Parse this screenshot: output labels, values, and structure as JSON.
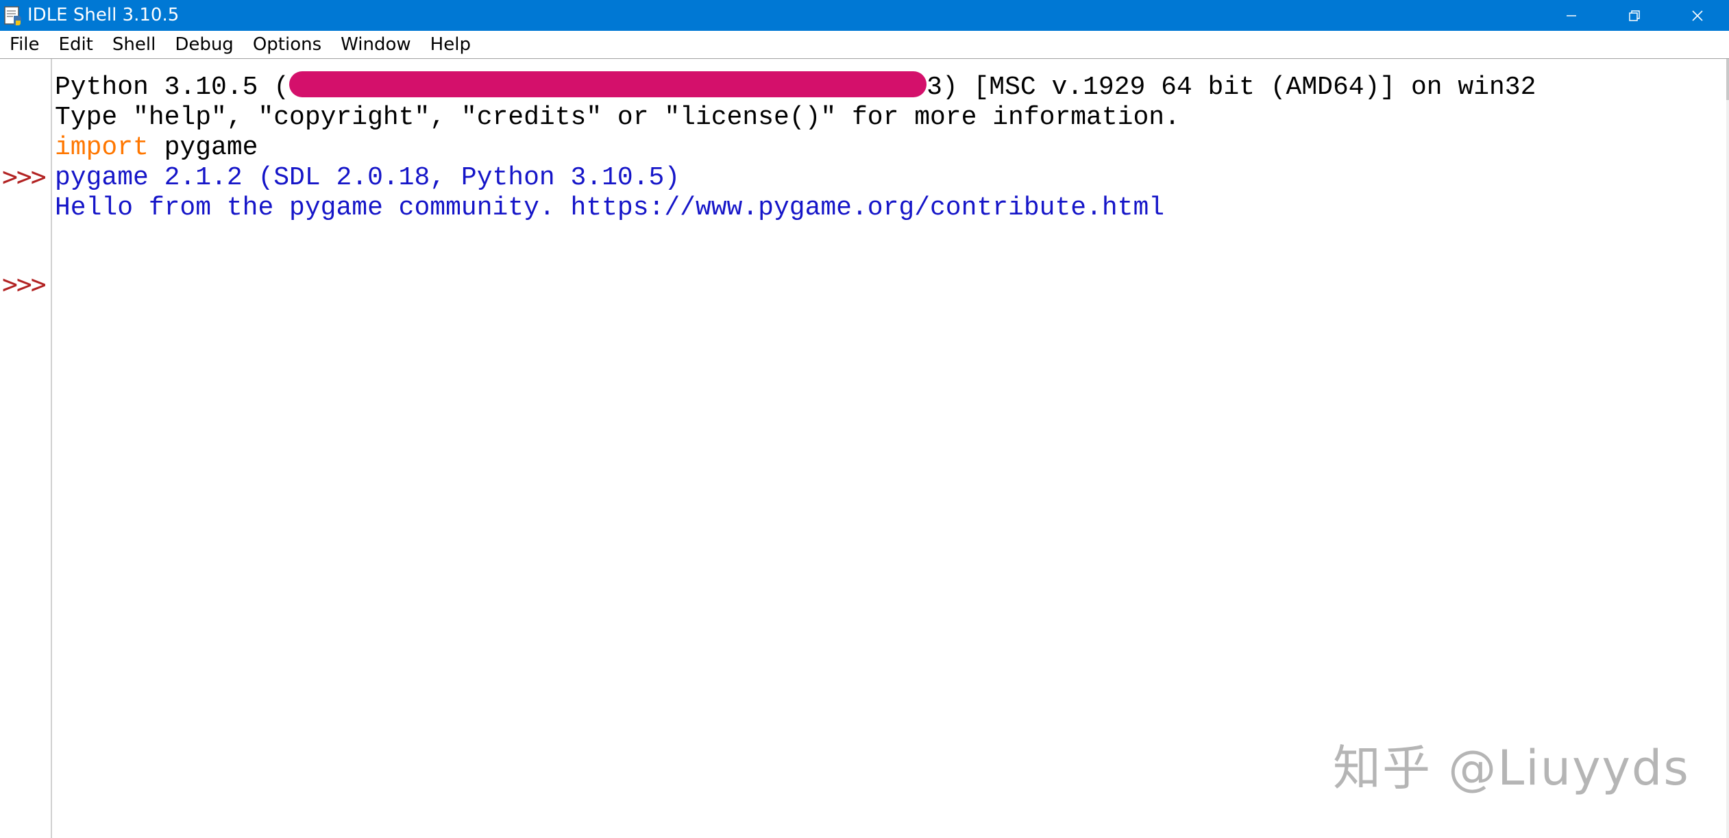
{
  "window": {
    "title": "IDLE Shell 3.10.5",
    "icon": "python-idle-icon",
    "controls": {
      "minimize_icon": "minimize-icon",
      "maximize_icon": "restore-icon",
      "close_icon": "close-icon"
    }
  },
  "menu": {
    "items": [
      {
        "label": "File"
      },
      {
        "label": "Edit"
      },
      {
        "label": "Shell"
      },
      {
        "label": "Debug"
      },
      {
        "label": "Options"
      },
      {
        "label": "Window"
      },
      {
        "label": "Help"
      }
    ]
  },
  "shell": {
    "prompt": ">>>",
    "banner_line1_prefix": "Python 3.10.5 (",
    "banner_line1_suffix": "3) [MSC v.1929 64 bit (AMD64)] on win32",
    "banner_line2": "Type \"help\", \"copyright\", \"credits\" or \"license()\" for more information.",
    "input_keyword": "import",
    "input_rest": " pygame",
    "output_line1": "pygame 2.1.2 (SDL 2.0.18, Python 3.10.5)",
    "output_line2": "Hello from the pygame community. https://www.pygame.org/contribute.html"
  },
  "watermark": {
    "text": "知乎 @Liuyyds"
  },
  "colors": {
    "titlebar": "#0078d4",
    "keyword": "#ff7700",
    "output": "#1515c8",
    "prompt": "#b22222",
    "redaction": "#d4106b"
  }
}
